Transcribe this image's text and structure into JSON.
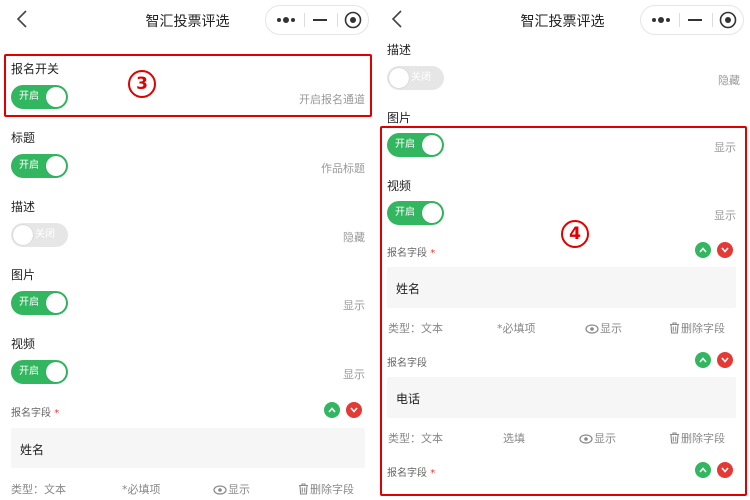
{
  "nav": {
    "title": "智汇投票评选"
  },
  "left": {
    "signup": {
      "label": "报名开关",
      "toggle": "开启",
      "hint": "开启报名通道"
    },
    "title_row": {
      "label": "标题",
      "toggle": "开启",
      "hint": "作品标题"
    },
    "desc_row": {
      "label": "描述",
      "toggle": "关闭",
      "hint": "隐藏"
    },
    "image_row": {
      "label": "图片",
      "toggle": "开启",
      "hint": "显示"
    },
    "video_row": {
      "label": "视频",
      "toggle": "开启",
      "hint": "显示"
    },
    "field1": {
      "title": "报名字段",
      "star": "*",
      "value": "姓名",
      "type": "类型：文本",
      "required": "*必填项",
      "show": "显示",
      "delete": "删除字段"
    },
    "badge": "3"
  },
  "right": {
    "desc_row": {
      "label": "描述",
      "toggle": "关闭",
      "hint": "隐藏"
    },
    "image_row": {
      "label": "图片",
      "toggle": "开启",
      "hint": "显示"
    },
    "video_row": {
      "label": "视频",
      "toggle": "开启",
      "hint": "显示"
    },
    "field1": {
      "title": "报名字段",
      "star": "*",
      "value": "姓名",
      "type": "类型：文本",
      "required": "*必填项",
      "show": "显示",
      "delete": "删除字段"
    },
    "field2": {
      "title": "报名字段",
      "value": "电话",
      "type": "类型：文本",
      "optional": "选填",
      "show": "显示",
      "delete": "删除字段"
    },
    "field3": {
      "title": "报名字段",
      "star": "*"
    },
    "badge": "4"
  },
  "colors": {
    "accent_green": "#32b660",
    "danger_red": "#e53935",
    "highlight_red": "#e00000"
  }
}
